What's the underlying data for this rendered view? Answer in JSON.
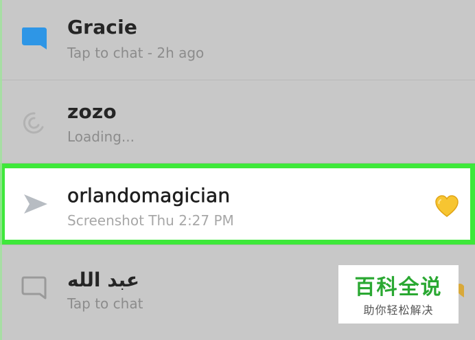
{
  "chats": [
    {
      "name": "Gracie",
      "status": "Tap to chat - 2h ago",
      "icon": "chat-bubble-filled-blue",
      "highlighted": false
    },
    {
      "name": "zozo",
      "status": "Loading...",
      "icon": "loading-spinner",
      "highlighted": false
    },
    {
      "name": "orlandomagician",
      "status": "Screenshot Thu 2:27 PM",
      "icon": "sent-arrow",
      "badge": "yellow-heart",
      "highlighted": true
    },
    {
      "name": "عبد الله",
      "status": "Tap to chat",
      "icon": "chat-bubble-outline",
      "highlighted": false
    }
  ],
  "colors": {
    "highlight_border": "#3ee83a",
    "chat_icon_blue": "#2e96e6",
    "heart_yellow": "#f7c531",
    "watermark_green": "#2aa832"
  },
  "watermark": {
    "title": "百科全说",
    "subtitle": "助你轻松解决"
  }
}
